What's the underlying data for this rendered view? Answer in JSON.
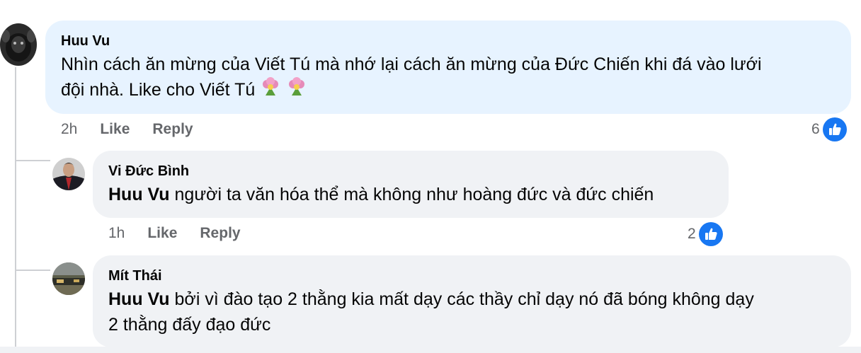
{
  "comments": [
    {
      "author": "Huu Vu",
      "text": "Nhìn cách ăn mừng của Viết Tú mà nhớ lại cách ăn mừng của Đức Chiến khi đá vào lưới",
      "text_line2": "đội nhà. Like cho Viết Tú",
      "emoji": [
        "bouquet-emoji",
        "bouquet-emoji"
      ],
      "time": "2h",
      "like_label": "Like",
      "reply_label": "Reply",
      "reaction_count": "6"
    },
    {
      "author": "Vi Đức Bình",
      "mention": "Huu Vu",
      "text": "người ta văn hóa thể mà không như hoàng đức và đức chiến",
      "time": "1h",
      "like_label": "Like",
      "reply_label": "Reply",
      "reaction_count": "2"
    },
    {
      "author": "Mít Thái",
      "mention": "Huu Vu",
      "text": "bởi vì đào tạo 2 thằng kia mất dạy các thầy chỉ dạy nó đã bóng không dạy",
      "text_line2": "2 thằng đấy đạo đức"
    }
  ],
  "colors": {
    "bubble": "#f0f2f5",
    "highlight_bubble": "#e7f3ff",
    "like_blue": "#1877f2",
    "meta_text": "#65676b"
  }
}
